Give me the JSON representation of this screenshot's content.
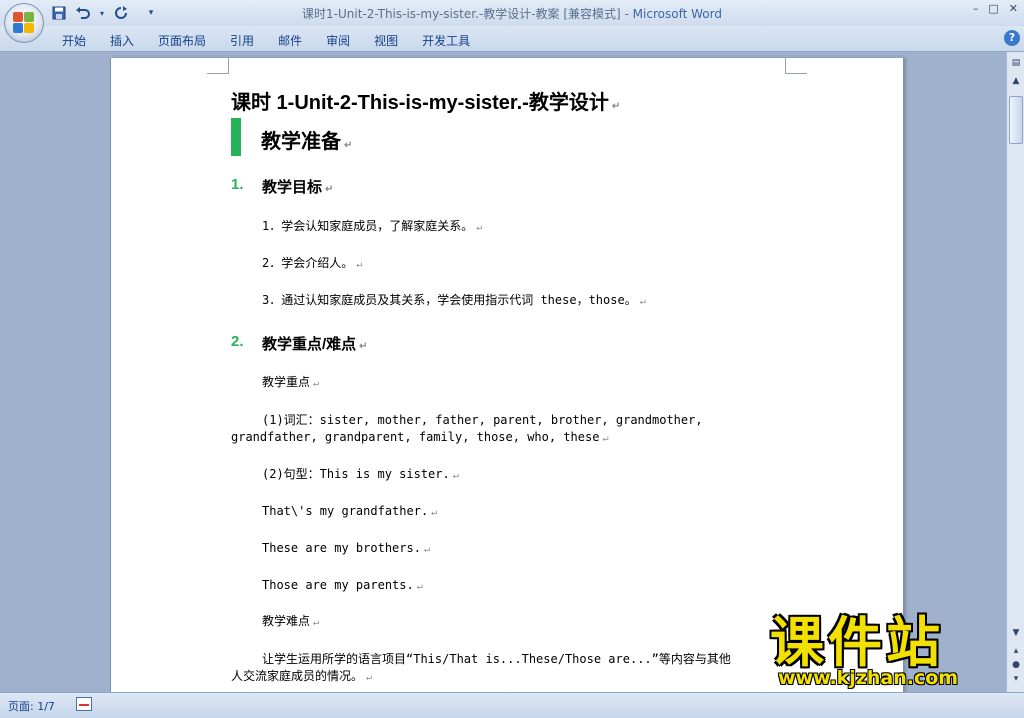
{
  "window": {
    "title_doc": "课时1-Unit-2-This-is-my-sister.-教学设计-教案 [兼容模式] - ",
    "title_app": "Microsoft Word",
    "controls": [
      "–",
      "□",
      "✕"
    ]
  },
  "quick_access": [
    "save-icon",
    "undo-icon",
    "redo-icon",
    "customize-icon"
  ],
  "ribbon": {
    "tabs": [
      "开始",
      "插入",
      "页面布局",
      "引用",
      "邮件",
      "审阅",
      "视图",
      "开发工具"
    ],
    "help_label": "?"
  },
  "document": {
    "title": "课时 1-Unit-2-This-is-my-sister.-教学设计",
    "section_heading": "教学准备",
    "heading1": {
      "num": "1.",
      "text": "教学目标"
    },
    "objectives": [
      "1．学会认知家庭成员，了解家庭关系。",
      "2．学会介绍人。",
      "3．通过认知家庭成员及其关系，学会使用指示代词 these，those。"
    ],
    "heading2": {
      "num": "2.",
      "text": "教学重点/难点"
    },
    "key_points_label": "教学重点",
    "vocab_line1": "(1)词汇：sister, mother, father, parent, brother, grandmother,",
    "vocab_line2": "grandfather, grandparent, family, those, who, these",
    "pattern_line": "(2)句型：This is my sister.",
    "sentences": [
      "That\\'s my grandfather.",
      "These are my brothers.",
      "Those are my parents."
    ],
    "difficulty_label": "教学难点",
    "difficulty_line1": "让学生运用所学的语言项目“This/That is...These/Those are...”等内容与其他",
    "difficulty_line2": "人交流家庭成员的情况。",
    "para_mark": "↵"
  },
  "watermark": {
    "text": "课件站",
    "url": "www.kjzhan.com"
  },
  "statusbar": {
    "page": "页面: 1/7"
  }
}
